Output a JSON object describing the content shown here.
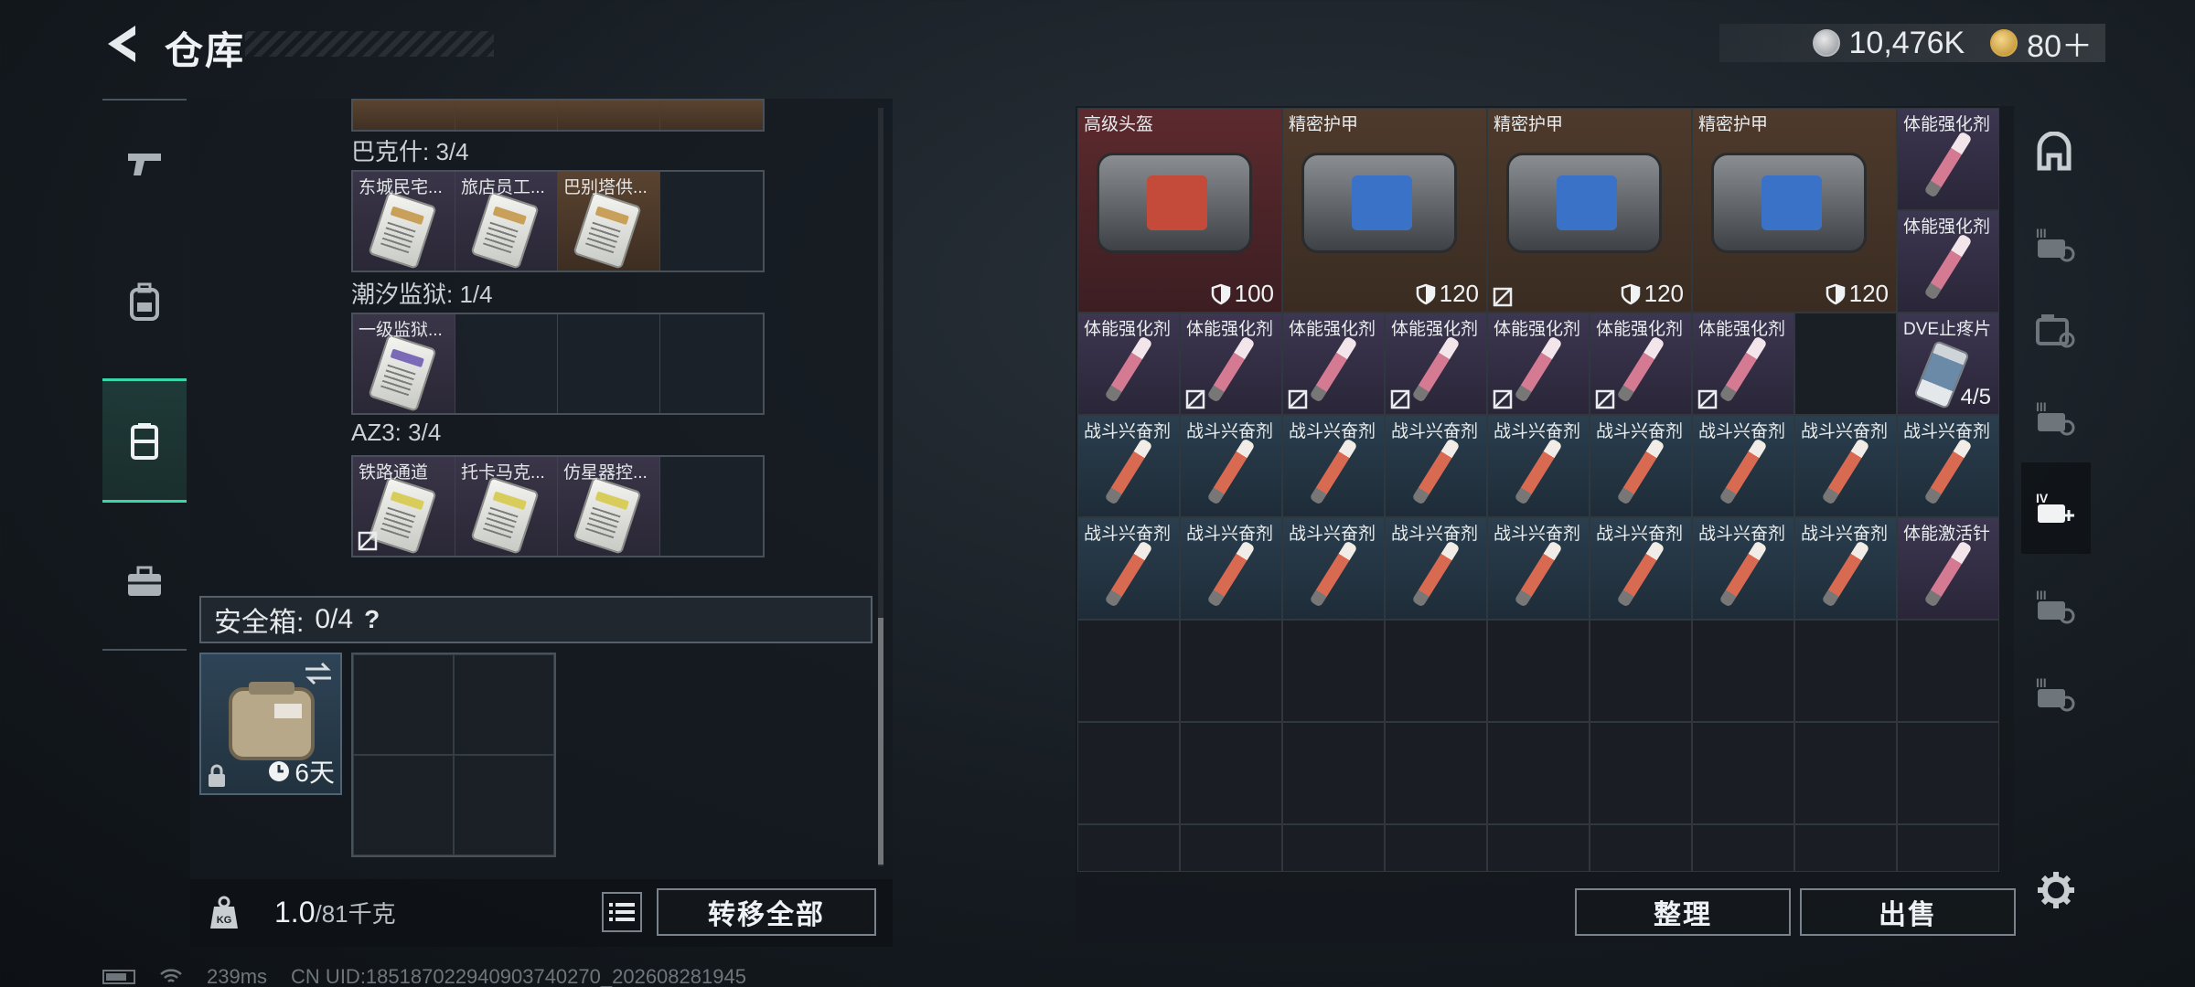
{
  "header": {
    "title": "仓库",
    "currency_silver": "10,476K",
    "currency_gold": "80＋"
  },
  "left_nav": {
    "items": [
      {
        "icon": "pistol-icon"
      },
      {
        "icon": "backpack-icon"
      },
      {
        "icon": "chest-rig-icon",
        "active": true
      },
      {
        "icon": "toolbox-icon"
      }
    ]
  },
  "keycard_sections": [
    {
      "label": "巴克什: 3/4",
      "slots": [
        {
          "name": "东城民宅...",
          "color": "purple",
          "stripe": "#c9a05a"
        },
        {
          "name": "旅店员工...",
          "color": "purple",
          "stripe": "#c9a05a"
        },
        {
          "name": "巴别塔供...",
          "color": "brown",
          "stripe": "#c9a05a"
        },
        {
          "name": "",
          "color": "empty"
        }
      ]
    },
    {
      "label": "潮汐监狱: 1/4",
      "slots": [
        {
          "name": "一级监狱...",
          "color": "purple",
          "stripe": "#7a6ab8"
        },
        {
          "name": "",
          "color": "empty"
        },
        {
          "name": "",
          "color": "empty"
        },
        {
          "name": "",
          "color": "empty"
        }
      ]
    },
    {
      "label": "AZ3: 3/4",
      "slots": [
        {
          "name": "铁路通道",
          "color": "purple",
          "stripe": "#d8cc5a",
          "nocarry": true
        },
        {
          "name": "托卡马克...",
          "color": "purple",
          "stripe": "#d8cc5a"
        },
        {
          "name": "仿星器控...",
          "color": "purple",
          "stripe": "#d8cc5a"
        },
        {
          "name": "",
          "color": "empty"
        }
      ]
    }
  ],
  "safebox": {
    "label": "安全箱:",
    "count": "0/4",
    "help": "?",
    "timer": "6天"
  },
  "footer": {
    "weight_current": "1.0",
    "weight_max": "/81千克",
    "transfer_all": "转移全部",
    "sort": "整理",
    "sell": "出售"
  },
  "inventory": {
    "row1": [
      {
        "name": "高级头盔",
        "durability": "100",
        "bg": "red",
        "panel": "#c44a3a"
      },
      {
        "name": "精密护甲",
        "durability": "120",
        "bg": "brown",
        "panel": "#3a72c8"
      },
      {
        "name": "精密护甲",
        "durability": "120",
        "bg": "brown",
        "panel": "#3a72c8"
      },
      {
        "name": "精密护甲",
        "durability": "120",
        "bg": "brown",
        "panel": "#3a72c8"
      }
    ],
    "row1_side": [
      {
        "name": "体能强化剂"
      },
      {
        "name": "体能强化剂"
      }
    ],
    "row2": [
      {
        "name": "体能强化剂",
        "kind": "pink"
      },
      {
        "name": "体能强化剂",
        "kind": "pink"
      },
      {
        "name": "体能强化剂",
        "kind": "pink"
      },
      {
        "name": "体能强化剂",
        "kind": "pink"
      },
      {
        "name": "体能强化剂",
        "kind": "pink"
      },
      {
        "name": "体能强化剂",
        "kind": "pink"
      },
      {
        "name": "体能强化剂",
        "kind": "pink"
      },
      {
        "name": "",
        "kind": "empty"
      },
      {
        "name": "DVE止疼片",
        "kind": "bottle",
        "count": "4/5"
      }
    ],
    "row3": [
      "战斗兴奋剂",
      "战斗兴奋剂",
      "战斗兴奋剂",
      "战斗兴奋剂",
      "战斗兴奋剂",
      "战斗兴奋剂",
      "战斗兴奋剂",
      "战斗兴奋剂",
      "战斗兴奋剂"
    ],
    "row4": [
      "战斗兴奋剂",
      "战斗兴奋剂",
      "战斗兴奋剂",
      "战斗兴奋剂",
      "战斗兴奋剂",
      "战斗兴奋剂",
      "战斗兴奋剂",
      "战斗兴奋剂",
      "体能激活针"
    ]
  },
  "right_nav": {
    "items": [
      {
        "icon": "home-icon"
      },
      {
        "icon": "locked-tier3-icon"
      },
      {
        "icon": "locked-container-icon"
      },
      {
        "icon": "locked-tier3-icon"
      },
      {
        "icon": "tier4-add-icon",
        "active": true
      },
      {
        "icon": "locked-tier3-icon"
      },
      {
        "icon": "locked-tier3-icon"
      }
    ]
  },
  "status": {
    "ping": "239ms",
    "uid": "CN UID:185187022940903740270_202608281945"
  },
  "colors": {
    "accent": "#39d7a7",
    "rarity_red": "#5c2a2e",
    "rarity_brown": "#4e3a2c",
    "rarity_purple": "#3c3650",
    "rarity_blue": "#2a3e4e"
  }
}
